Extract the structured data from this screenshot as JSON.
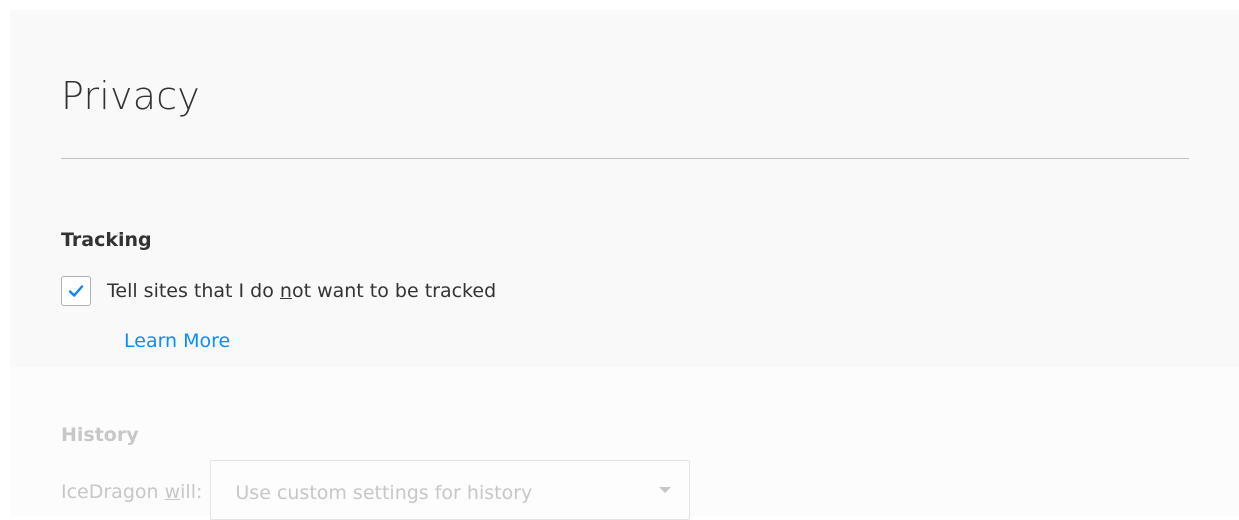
{
  "page": {
    "title": "Privacy"
  },
  "tracking": {
    "heading": "Tracking",
    "dnt_checkbox": {
      "checked": true,
      "label_before": "Tell sites that I do ",
      "label_accesskey": "n",
      "label_after": "ot want to be tracked"
    },
    "learn_more": "Learn More"
  },
  "history": {
    "heading": "History",
    "prefix_before": "IceDragon ",
    "prefix_accesskey": "w",
    "prefix_after": "ill:",
    "select_value": "Use custom settings for history"
  },
  "colors": {
    "background": "#f9f9fa",
    "text": "#333333",
    "link": "#0a8dff",
    "checkmark": "#0a84ff",
    "divider": "#c1c1c1",
    "disabled_text": "#c7c7c7"
  }
}
